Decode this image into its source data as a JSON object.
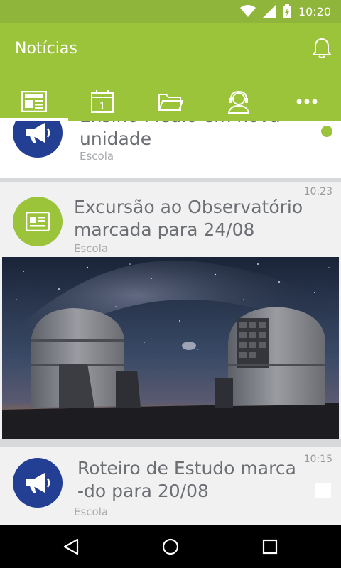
{
  "status": {
    "time": "10:20"
  },
  "appbar": {
    "title": "Notícias"
  },
  "tabs": [
    {
      "name": "news",
      "icon": "newspaper-icon"
    },
    {
      "name": "calendar",
      "icon": "calendar-icon",
      "day": "1"
    },
    {
      "name": "files",
      "icon": "folder-icon"
    },
    {
      "name": "contact",
      "icon": "support-agent-icon"
    },
    {
      "name": "more",
      "icon": "more-dots-icon"
    }
  ],
  "feed": {
    "items": [
      {
        "title_line1": "Ensino Médio em nova",
        "title_line2": "unidade",
        "source": "Escola",
        "unread": true
      },
      {
        "time": "10:23",
        "title_line1": "Excursão ao Observatório",
        "title_line2": "marcada para 24/08",
        "source": "Escola"
      },
      {
        "time": "10:15",
        "title_line1": "Roteiro de Estudo marca",
        "title_line2": "-do para 20/08",
        "source": "Escola"
      }
    ]
  },
  "colors": {
    "appbar": "#9bc43b",
    "statusbar": "#8fb53a",
    "announce": "#233f94",
    "news": "#9bc43b",
    "unread_dot": "#9bc43b"
  }
}
